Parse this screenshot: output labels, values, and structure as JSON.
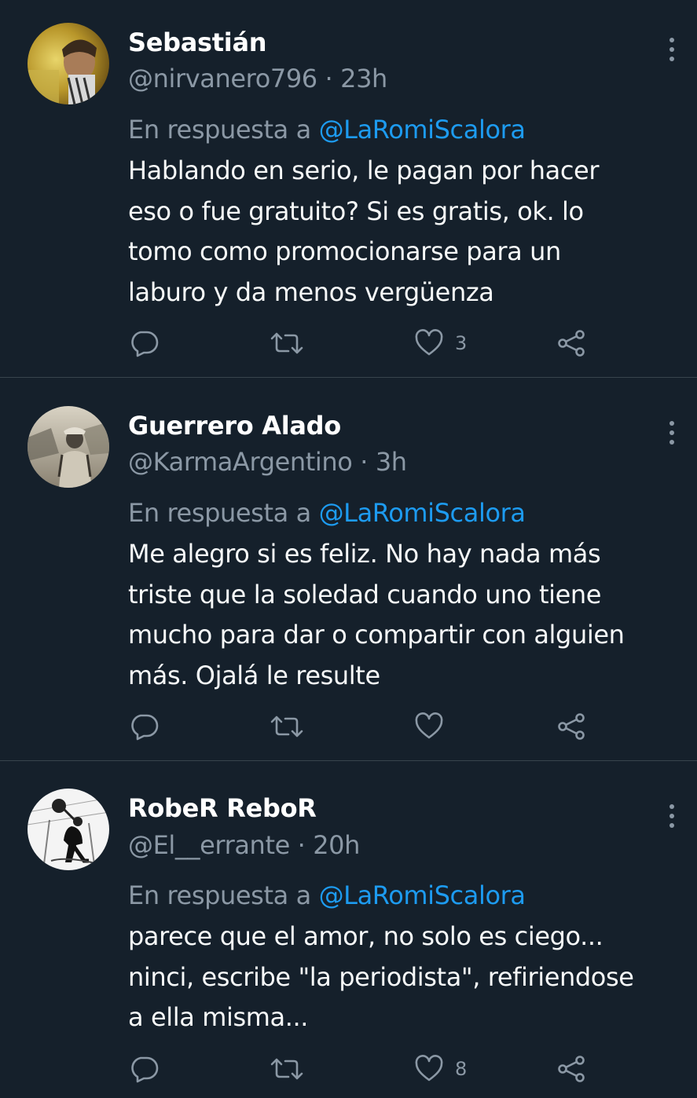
{
  "tweets": [
    {
      "name": "Sebastián",
      "handle": "@nirvanero796",
      "time": "23h",
      "reply_prefix": "En respuesta a",
      "reply_mention": "@LaRomiScalora",
      "lines": [
        "Hablando en serio, le pagan por hacer",
        "eso o fue gratuito? Si es gratis, ok. lo",
        "tomo como promocionarse para un",
        "laburo y da menos vergüenza"
      ],
      "likes": "3"
    },
    {
      "name": "Guerrero Alado",
      "handle": "@KarmaArgentino",
      "time": "3h",
      "reply_prefix": "En respuesta a",
      "reply_mention": "@LaRomiScalora",
      "lines": [
        "Me alegro si es feliz. No hay nada más",
        "triste que la soledad cuando uno tiene",
        "mucho para dar o compartir con alguien",
        "más. Ojalá le resulte"
      ],
      "likes": ""
    },
    {
      "name": "RobeR ReboR",
      "handle": "@El__errante",
      "time": "20h",
      "reply_prefix": "En respuesta a",
      "reply_mention": "@LaRomiScalora",
      "lines": [
        "parece que el amor, no solo es ciego...",
        "ninci, escribe \"la periodista\", refiriendose",
        "a ella misma..."
      ],
      "likes": "8"
    }
  ],
  "separator": "·",
  "icons": [
    "more-icon",
    "reply-icon",
    "retweet-icon",
    "like-icon",
    "share-icon"
  ],
  "colors": {
    "background": "#15202b",
    "text": "#f7f9f9",
    "secondary": "#8b98a5",
    "mention": "#1d9bf0",
    "divider": "#38444d"
  }
}
